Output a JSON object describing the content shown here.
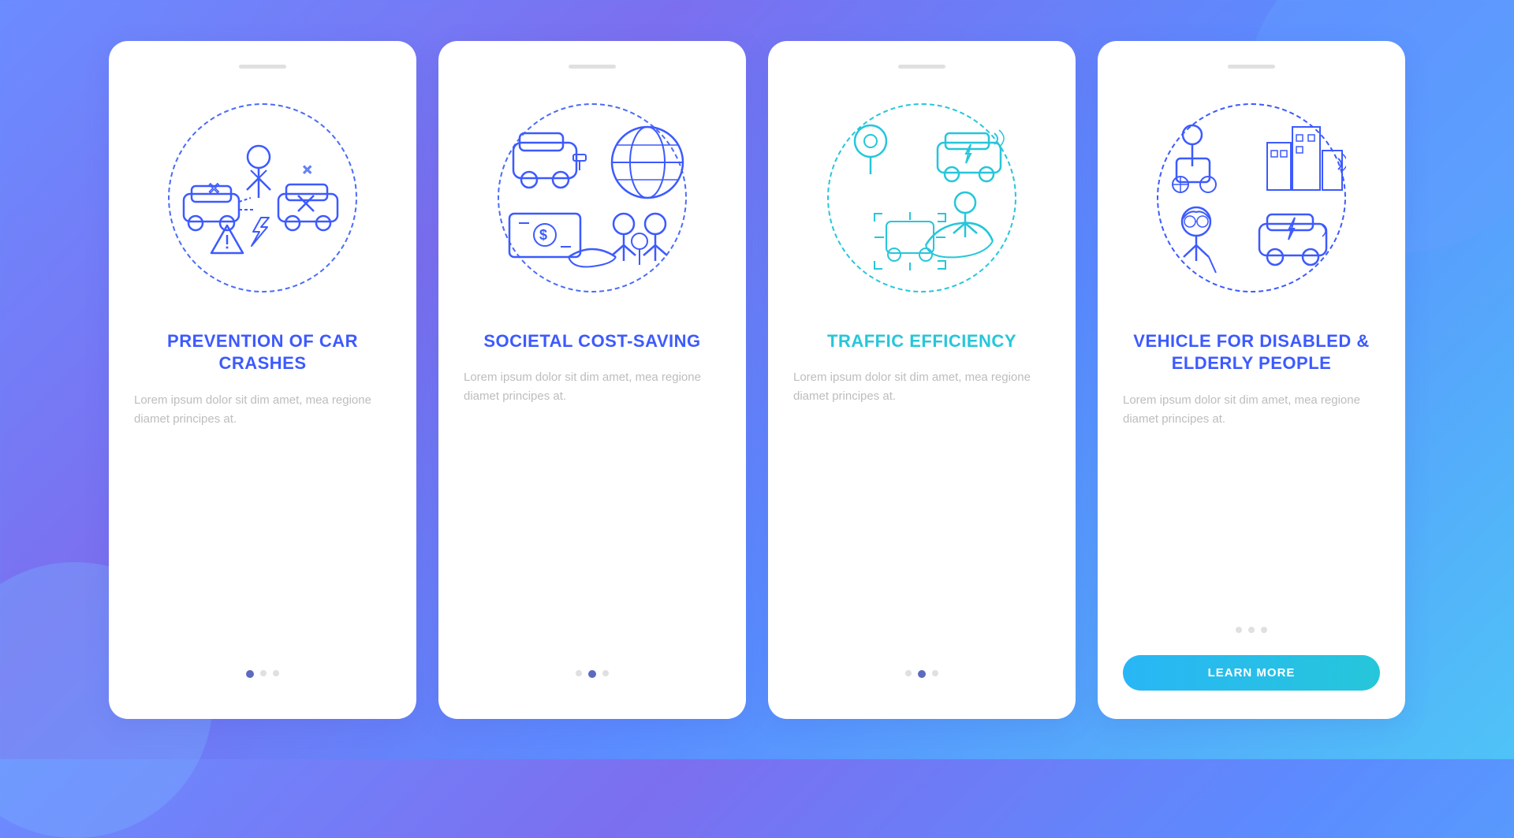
{
  "cards": [
    {
      "id": "card-1",
      "notch": true,
      "title": "PREVENTION OF CAR CRASHES",
      "body_text": "Lorem ipsum dolor sit dim amet, mea regione diamet principes at.",
      "dots": [
        true,
        false,
        false
      ],
      "button": null,
      "icon_label": "car-crash-prevention-icon",
      "dot_active": 0
    },
    {
      "id": "card-2",
      "notch": true,
      "title": "SOCIETAL COST-SAVING",
      "body_text": "Lorem ipsum dolor sit dim amet, mea regione diamet principes at.",
      "dots": [
        false,
        true,
        false
      ],
      "button": null,
      "icon_label": "societal-cost-saving-icon",
      "dot_active": 1
    },
    {
      "id": "card-3",
      "notch": true,
      "title": "TRAFFIC EFFICIENCY",
      "body_text": "Lorem ipsum dolor sit dim amet, mea regione diamet principes at.",
      "dots": [
        false,
        true,
        false
      ],
      "button": null,
      "icon_label": "traffic-efficiency-icon",
      "dot_active": 1
    },
    {
      "id": "card-4",
      "notch": true,
      "title": "VEHICLE FOR DISABLED & ELDERLY PEOPLE",
      "body_text": "Lorem ipsum dolor sit dim amet, mea regione diamet principes at.",
      "dots": [
        false,
        false,
        false
      ],
      "button": "LEARN MORE",
      "icon_label": "vehicle-disabled-elderly-icon",
      "dot_active": -1
    }
  ],
  "background_gradient": "linear-gradient(135deg, #6b8cff 0%, #7b6fef 30%, #5b8cff 60%, #4fc3f7 100%)"
}
